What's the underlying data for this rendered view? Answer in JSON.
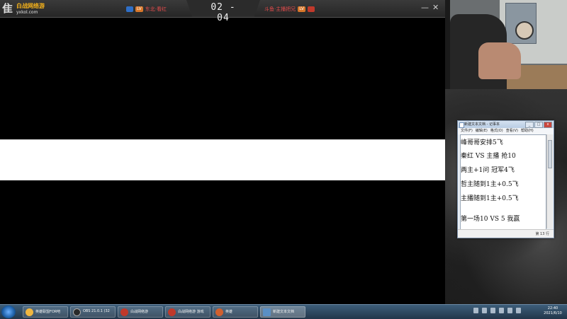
{
  "game": {
    "logo_mark": "隹",
    "logo_name": "白战网络游",
    "logo_site": "yxkol.com",
    "left_team": {
      "name": "东北·看红",
      "rank": "LV"
    },
    "right_team": {
      "name": "斗鱼·主播把兄",
      "rank": "LV"
    },
    "score": "02 - 04",
    "minimize": "—",
    "close": "✕"
  },
  "notepad": {
    "title": "新建文本文档 - 记事本",
    "menu": [
      "文件(F)",
      "编辑(E)",
      "格式(O)",
      "查看(V)",
      "帮助(H)"
    ],
    "lines": [
      "  峰哥哥安排5飞",
      " 秦红  VS  主播 抢10",
      "两主+1问  冠军4飞",
      " 哲主随到1主+0.5飞",
      " 主播随到1主+0.5飞",
      "",
      " 第一场10 VS  5  我赢"
    ],
    "status": "第 13 行",
    "minimize": "_",
    "maximize": "□",
    "close": "x"
  },
  "taskbar": {
    "items": [
      {
        "label": "英雄联盟FOR吧",
        "color": "#f0b640"
      },
      {
        "label": "OBS 21.0.1 (32",
        "color": "#2a2a2a"
      },
      {
        "label": "白战网络游",
        "color": "#c0392b"
      },
      {
        "label": "白战网络游 游戏",
        "color": "#c0392b"
      },
      {
        "label": "英雄",
        "color": "#d0602f"
      },
      {
        "label": "新建文本文档",
        "color": "#5a8fc5"
      }
    ],
    "clock_time": "22:40",
    "clock_date": "2021/6/10"
  },
  "colors": {
    "accent": "#f5b21b",
    "team": "#e54c4c"
  }
}
